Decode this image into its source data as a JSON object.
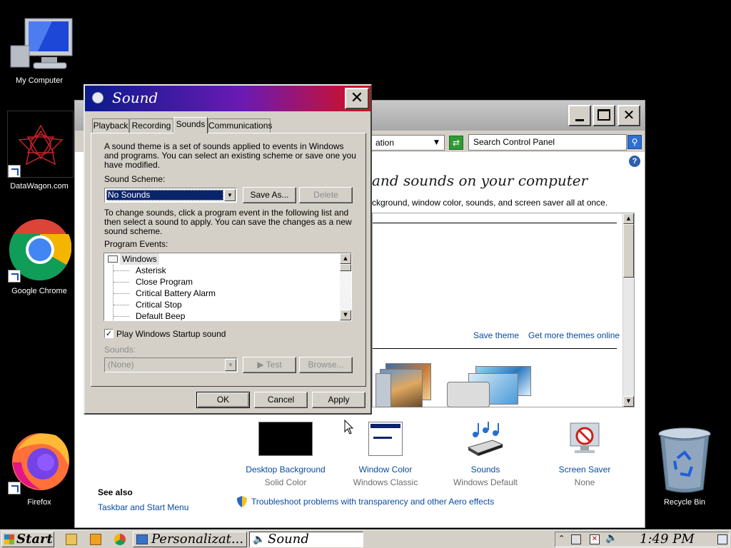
{
  "desktop": {
    "icons": [
      {
        "label": "My Computer"
      },
      {
        "label": "DataWagon.com"
      },
      {
        "label": "Google Chrome"
      },
      {
        "label": "Firefox"
      },
      {
        "label": "Recycle Bin"
      }
    ]
  },
  "control_panel": {
    "address_text": "ation",
    "search_placeholder": "Search Control Panel",
    "heading": "and sounds on your computer",
    "subheading": "ckground, window color, sounds, and screen saver all at once.",
    "save_theme": "Save theme",
    "get_more_themes": "Get more themes online",
    "items": [
      {
        "label": "Desktop Background",
        "value": "Solid Color"
      },
      {
        "label": "Window Color",
        "value": "Windows Classic"
      },
      {
        "label": "Sounds",
        "value": "Windows Default"
      },
      {
        "label": "Screen Saver",
        "value": "None"
      }
    ],
    "see_also_title": "See also",
    "see_also_link": "Taskbar and Start Menu",
    "troubleshoot": "Troubleshoot problems with transparency and other Aero effects"
  },
  "dialog": {
    "title": "Sound",
    "close_glyph": "✕",
    "tabs": [
      {
        "label": "Playback"
      },
      {
        "label": "Recording"
      },
      {
        "label": "Sounds"
      },
      {
        "label": "Communications"
      }
    ],
    "description_lines": [
      "A sound theme is a set of sounds applied to events in Windows",
      "and programs.  You can select an existing scheme or save one you",
      "have modified."
    ],
    "scheme_label": "Sound Scheme:",
    "scheme_value": "No Sounds",
    "save_as": "Save As...",
    "delete": "Delete",
    "change_lines": [
      "To change sounds, click a program event in the following list and",
      "then select a sound to apply.  You can save the changes as a new",
      "sound scheme."
    ],
    "events_label": "Program Events:",
    "events": [
      "Windows",
      "Asterisk",
      "Close Program",
      "Critical Battery Alarm",
      "Critical Stop",
      "Default Beep"
    ],
    "startup_label": "Play Windows Startup sound",
    "startup_checked": true,
    "sounds_label": "Sounds:",
    "sounds_value": "(None)",
    "test": "Test",
    "browse": "Browse...",
    "ok": "OK",
    "cancel": "Cancel",
    "apply": "Apply"
  },
  "taskbar": {
    "start": "Start",
    "tasks": [
      {
        "label": "Personalizat..."
      },
      {
        "label": "Sound"
      }
    ],
    "clock": "1:49 PM"
  },
  "colors": {
    "dialog_title_gradient": [
      "#0a1a8c",
      "#6a1ab4",
      "#d9101a"
    ],
    "link": "#0a4ba0",
    "selection": "#0a246a"
  }
}
